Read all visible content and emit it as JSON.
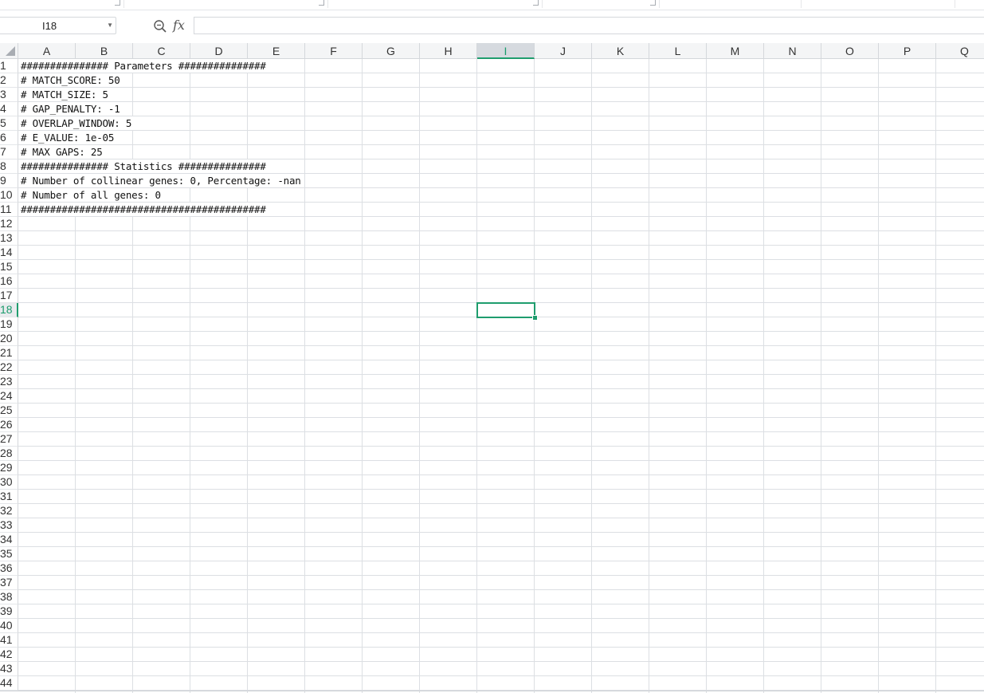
{
  "formula_bar": {
    "name_box": "I18",
    "fx_label": "fx",
    "formula": ""
  },
  "columns": [
    "A",
    "B",
    "C",
    "D",
    "E",
    "F",
    "G",
    "H",
    "I",
    "J",
    "K",
    "L",
    "M",
    "N",
    "O",
    "P",
    "Q"
  ],
  "active_column": "I",
  "active_row": 18,
  "rows": [
    "1",
    "2",
    "3",
    "4",
    "5",
    "6",
    "7",
    "8",
    "9",
    "10",
    "11",
    "12",
    "13",
    "14",
    "15",
    "16",
    "17",
    "18",
    "19",
    "20",
    "21",
    "22",
    "23",
    "24",
    "25",
    "26",
    "27",
    "28",
    "29",
    "30",
    "31",
    "32",
    "33",
    "34",
    "35",
    "36",
    "37",
    "38",
    "39",
    "40",
    "41",
    "42",
    "43",
    "44"
  ],
  "cells": [
    "############### Parameters ###############",
    "# MATCH_SCORE: 50",
    "# MATCH_SIZE: 5",
    "# GAP_PENALTY: -1",
    "# OVERLAP_WINDOW: 5",
    "# E_VALUE: 1e-05",
    "# MAX GAPS: 25",
    "############### Statistics ###############",
    "# Number of collinear genes: 0, Percentage: -nan",
    "# Number of all genes: 0",
    "##########################################"
  ],
  "colors": {
    "accent": "#1f9d6e",
    "grid": "#dcdfe3",
    "header_bg": "#f4f5f6"
  },
  "icons": {
    "zoom": "zoom-icon",
    "function": "fx-icon",
    "dropdown": "chevron-down-icon"
  }
}
